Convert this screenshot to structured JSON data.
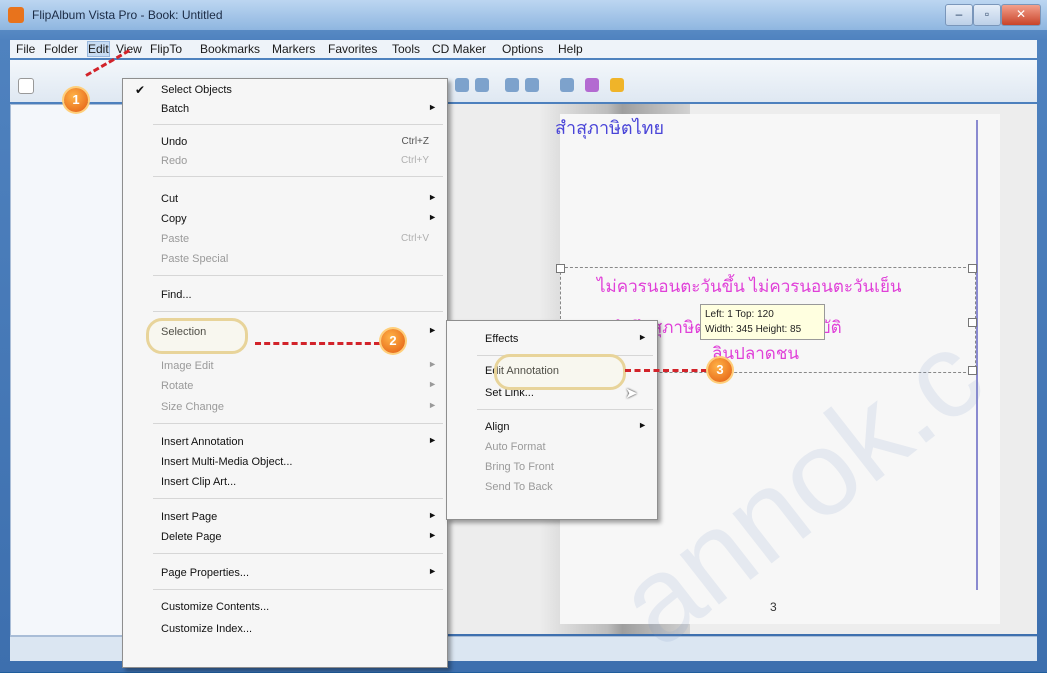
{
  "window": {
    "title": "FlipAlbum Vista Pro - Book: Untitled",
    "controls": [
      "–",
      "▫",
      "✕"
    ]
  },
  "menubar": {
    "items": [
      "File",
      "Folder",
      "Edit",
      "View",
      "FlipTo",
      "Bookmarks",
      "Markers",
      "Favorites",
      "Tools",
      "CD Maker",
      "Options",
      "Help"
    ]
  },
  "page": {
    "title": "สำสุภาษิตไทย",
    "line1": "ไม่ควรนอนตะวันขึ้น ไม่ควรนอนตะวันเย็น",
    "line2": "สำนึกสุภาษิตทุกคำนึงควรปฏิบัติ",
    "line3": "ลินปลาดชน",
    "page_number": "3"
  },
  "tooltip": {
    "line1": "Left: 1 Top: 120",
    "line2": "Width: 345 Height: 85"
  },
  "edit_menu": {
    "items": [
      {
        "label": "Select Objects",
        "checked": true
      },
      {
        "label": "Batch",
        "submenu": true
      },
      {
        "label": "Undo",
        "shortcut": "Ctrl+Z"
      },
      {
        "label": "Redo",
        "shortcut": "Ctrl+Y",
        "disabled": true
      },
      {
        "label": "Cut",
        "submenu": true
      },
      {
        "label": "Copy",
        "submenu": true
      },
      {
        "label": "Paste",
        "shortcut": "Ctrl+V",
        "disabled": true
      },
      {
        "label": "Paste Special",
        "disabled": true
      },
      {
        "label": "Find..."
      },
      {
        "label": "Selection",
        "submenu": true
      },
      {
        "label": "Image Edit",
        "submenu": true,
        "disabled": true
      },
      {
        "label": "Rotate",
        "submenu": true,
        "disabled": true
      },
      {
        "label": "Size Change",
        "submenu": true,
        "disabled": true
      },
      {
        "label": "Insert Annotation",
        "submenu": true
      },
      {
        "label": "Insert Multi-Media Object..."
      },
      {
        "label": "Insert Clip Art..."
      },
      {
        "label": "Insert Page",
        "submenu": true
      },
      {
        "label": "Delete Page",
        "submenu": true
      },
      {
        "label": "Page Properties...",
        "submenu": true
      },
      {
        "label": "Customize Contents..."
      },
      {
        "label": "Customize Index..."
      }
    ]
  },
  "selection_submenu": {
    "items": [
      {
        "label": "Effects",
        "submenu": true
      },
      {
        "label": "Edit Annotation"
      },
      {
        "label": "Set Link..."
      },
      {
        "label": "Align",
        "submenu": true
      },
      {
        "label": "Auto Format",
        "disabled": true
      },
      {
        "label": "Bring To Front",
        "disabled": true
      },
      {
        "label": "Send To Back",
        "disabled": true
      }
    ]
  },
  "steps": [
    "1",
    "2",
    "3"
  ],
  "watermark": "annok.c",
  "colors": {
    "accent_highlight": "#e8d49a",
    "step_badge": "#e25a10",
    "arrow": "#d2232a",
    "page_title": "#4a45d8",
    "page_text": "#e040d8"
  }
}
